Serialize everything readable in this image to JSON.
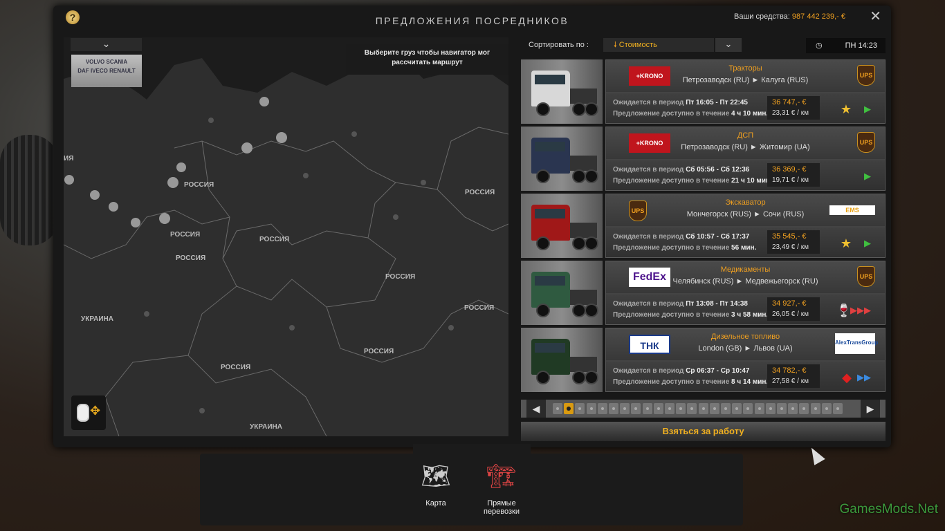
{
  "window": {
    "title": "ПРЕДЛОЖЕНИЯ ПОСРЕДНИКОВ",
    "help_label": "?",
    "close_label": "✕",
    "funds_label": "Ваши средства:",
    "funds_value": "987 442 239,- €"
  },
  "map": {
    "dropdown_label": "⌄",
    "brands": [
      "VOLVO",
      "SCANIA",
      "DAF",
      "IVECO",
      "RENAULT"
    ],
    "hint": "Выберите груз чтобы навигатор мог рассчитать маршрут",
    "labels": [
      "РОССИЯ",
      "РОССИЯ",
      "РОССИЯ",
      "РОССИЯ",
      "РОССИЯ",
      "РОССИЯ",
      "РОССИЯ",
      "РОССИЯ",
      "РОССИЯ",
      "РОССИЯ",
      "УКРАИНА",
      "УКРАИНА",
      "ИЯ"
    ]
  },
  "sort": {
    "label": "Сортировать по :",
    "selected": "Стоимость",
    "arrow": "⌄"
  },
  "clock": {
    "icon": "◷",
    "time": "ПН 14:23"
  },
  "offers": [
    {
      "cargo": "Тракторы",
      "route": "Петрозаводск (RU) ► Калуга (RUS)",
      "period_label": "Ожидается в период",
      "period": "Пт 16:05 - Пт 22:45",
      "avail_label": "Предложение доступно в течение",
      "avail": "4 ч 10 мин.",
      "price": "36 747,- €",
      "per_km": "23,31 € / км",
      "logo_left": "+KRONO",
      "logo_right": "UPS",
      "badge1": "★",
      "badge2": "▶",
      "truck_color": "#d8d8d8"
    },
    {
      "cargo": "ДСП",
      "route": "Петрозаводск (RU) ► Житомир (UA)",
      "period_label": "Ожидается в период",
      "period": "Сб 05:56 - Сб 12:36",
      "avail_label": "Предложение доступно в течение",
      "avail": "21 ч 10 мин.",
      "price": "36 369,- €",
      "per_km": "19,71 € / км",
      "logo_left": "+KRONO",
      "logo_right": "UPS",
      "badge1": "",
      "badge2": "▶",
      "truck_color": "#2a3550"
    },
    {
      "cargo": "Экскаватор",
      "route": "Мончегорск (RUS) ► Сочи (RUS)",
      "period_label": "Ожидается в период",
      "period": "Сб 10:57 - Сб 17:37",
      "avail_label": "Предложение доступно в течение",
      "avail": "56 мин.",
      "price": "35 545,- €",
      "per_km": "23,49 € / км",
      "logo_left": "UPS",
      "logo_right": "EMS",
      "badge1": "★",
      "badge2": "▶",
      "truck_color": "#a01818"
    },
    {
      "cargo": "Медикаменты",
      "route": "Челябинск (RUS) ► Медвежьегорск (RU)",
      "period_label": "Ожидается в период",
      "period": "Пт 13:08 - Пт 14:38",
      "avail_label": "Предложение доступно в течение",
      "avail": "3 ч 58 мин.",
      "price": "34 927,- €",
      "per_km": "26,05 € / км",
      "logo_left": "FedEx",
      "logo_right": "UPS",
      "badge1": "🍷",
      "badge2": "▶▶▶",
      "truck_color": "#2f5a40"
    },
    {
      "cargo": "Дизельное топливо",
      "route": "London (GB) ► Львов (UA)",
      "period_label": "Ожидается в период",
      "period": "Ср 06:37 - Ср 10:47",
      "avail_label": "Предложение доступно в течение",
      "avail": "8 ч 14 мин.",
      "price": "34 782,- €",
      "per_km": "27,58 € / км",
      "logo_left": "ТНК",
      "logo_right": "AlexTransGroup",
      "badge1": "◆",
      "badge2": "▶▶",
      "truck_color": "#203a24"
    }
  ],
  "pager": {
    "prev": "◀",
    "next": "▶",
    "total_pages": 26,
    "current_page": 2
  },
  "take_job_label": "Взяться за работу",
  "dock": [
    {
      "label": "Карта",
      "icon": "map-icon"
    },
    {
      "label": "Прямые перевозки",
      "icon": "forklift-icon"
    }
  ],
  "watermark": "GamesMods.Net",
  "colors": {
    "accent": "#f0a020",
    "panel": "#181818"
  }
}
